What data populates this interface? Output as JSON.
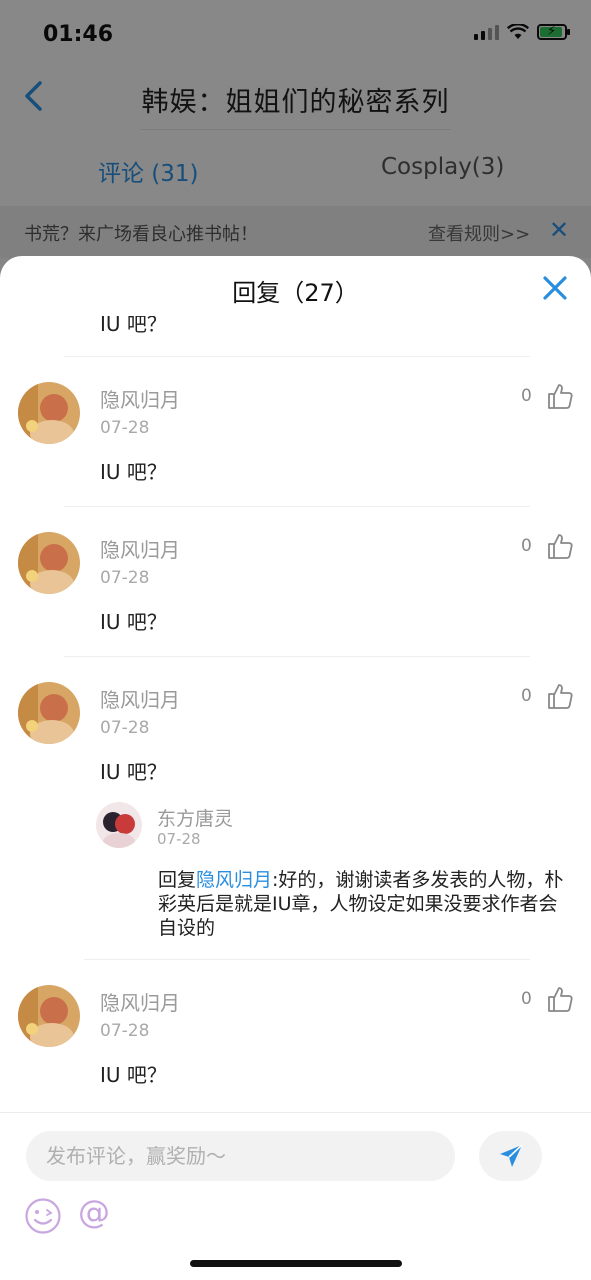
{
  "status_bar": {
    "time": "01:46"
  },
  "nav": {
    "title": "韩娱：姐姐们的秘密系列"
  },
  "tabs": [
    {
      "label": "评论 (31)",
      "active": true
    },
    {
      "label": "Cosplay(3)",
      "active": false
    }
  ],
  "notice": {
    "text": "书荒？来广场看良心推书帖！",
    "link": "查看规则>>"
  },
  "sheet": {
    "title": "回复（27）"
  },
  "partial_comment": {
    "text": "IU 吧？"
  },
  "comments": [
    {
      "username": "隐风归月",
      "date": "07-28",
      "likes": "0",
      "text": "IU 吧？"
    },
    {
      "username": "隐风归月",
      "date": "07-28",
      "likes": "0",
      "text": "IU 吧？"
    },
    {
      "username": "隐风归月",
      "date": "07-28",
      "likes": "0",
      "text": "IU 吧？",
      "reply": {
        "username": "东方唐灵",
        "date": "07-28",
        "prefix": "回复",
        "mention": "隐风归月",
        "body": ":好的，谢谢读者多发表的人物，朴彩英后是就是IU章，人物设定如果没要求作者会自设的"
      }
    },
    {
      "username": "隐风归月",
      "date": "07-28",
      "likes": "0",
      "text": "IU 吧？"
    }
  ],
  "input": {
    "placeholder": "发布评论，赢奖励～"
  },
  "colors": {
    "accent": "#2a8ee0",
    "emoji": "#c8a6e0"
  }
}
